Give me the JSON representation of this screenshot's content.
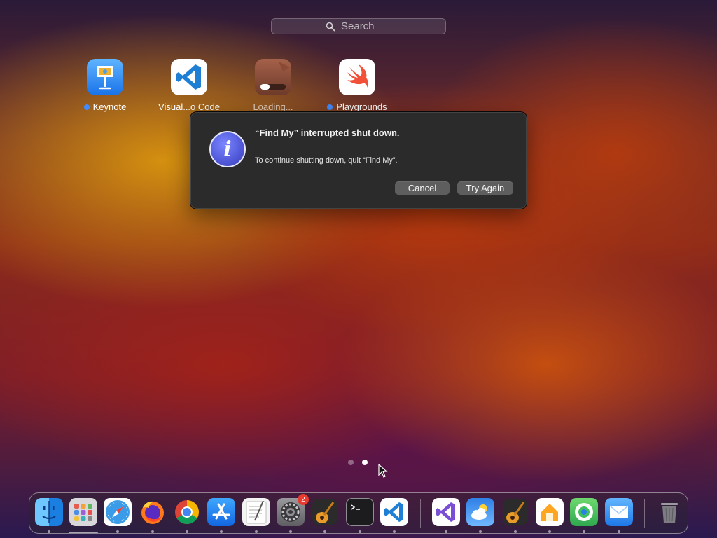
{
  "search": {
    "placeholder": "Search",
    "icon": "search-icon"
  },
  "launchpad": {
    "apps": [
      {
        "label": "Keynote",
        "icon": "keynote-icon",
        "new_dot": true
      },
      {
        "label": "Visual...o Code",
        "icon": "vscode-icon",
        "new_dot": false
      },
      {
        "label": "Loading...",
        "icon": "loading-app-icon",
        "new_dot": false,
        "progress": 0.35
      },
      {
        "label": "Playgrounds",
        "icon": "swift-playgrounds-icon",
        "new_dot": true
      }
    ],
    "pages": {
      "count": 2,
      "current": 2
    }
  },
  "dialog": {
    "icon": "info-icon",
    "title": "“Find My” interrupted shut down.",
    "message": "To continue shutting down, quit “Find My”.",
    "cancel_label": "Cancel",
    "retry_label": "Try Again"
  },
  "dock": {
    "apps": [
      {
        "name": "Finder",
        "icon": "finder-icon",
        "running": true
      },
      {
        "name": "Launchpad",
        "icon": "launchpad-icon",
        "running": false
      },
      {
        "name": "Safari",
        "icon": "safari-icon",
        "running": true
      },
      {
        "name": "Firefox",
        "icon": "firefox-icon",
        "running": true
      },
      {
        "name": "Chrome",
        "icon": "chrome-icon",
        "running": true
      },
      {
        "name": "App Store",
        "icon": "app-store-icon",
        "running": true
      },
      {
        "name": "TextEdit",
        "icon": "textedit-icon",
        "running": true
      },
      {
        "name": "System Settings",
        "icon": "settings-icon",
        "running": true,
        "badge": "2"
      },
      {
        "name": "GarageBand",
        "icon": "garageband-icon",
        "running": true
      },
      {
        "name": "Terminal",
        "icon": "terminal-icon",
        "running": true
      },
      {
        "name": "Visual Studio Code",
        "icon": "vscode-icon",
        "running": true
      },
      {
        "name": "Visual Studio",
        "icon": "visual-studio-icon",
        "running": true
      },
      {
        "name": "Weather",
        "icon": "weather-icon",
        "running": true
      },
      {
        "name": "GarageBand",
        "icon": "garageband-icon",
        "running": true
      },
      {
        "name": "Home",
        "icon": "home-icon",
        "running": true
      },
      {
        "name": "Find My",
        "icon": "find-my-icon",
        "running": true
      },
      {
        "name": "Mail",
        "icon": "mail-icon",
        "running": true
      },
      {
        "name": "Trash",
        "icon": "trash-icon",
        "running": false
      }
    ]
  }
}
